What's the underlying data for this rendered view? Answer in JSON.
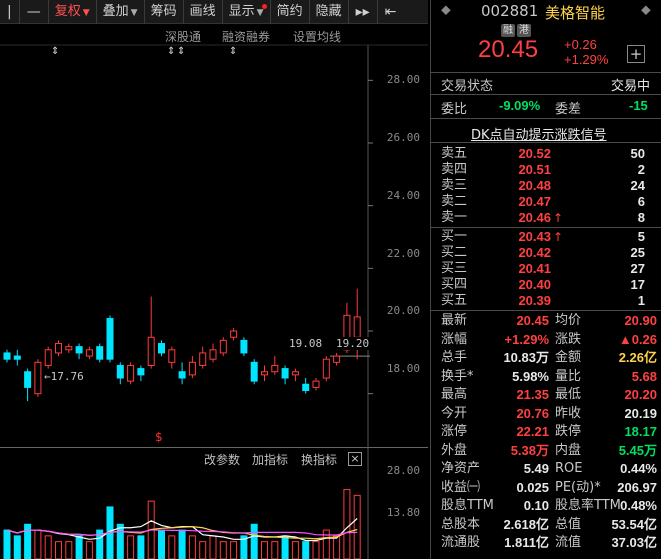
{
  "toolbar": {
    "collapse_label": "|",
    "minus_label": "—",
    "adjust_label": "复权",
    "overlay_label": "叠加",
    "chips_label": "筹码",
    "draw_label": "画线",
    "display_label": "显示",
    "simple_label": "简约",
    "hide_label": "隐藏",
    "next_label": "▸▸",
    "expand_label": "⇤"
  },
  "chart": {
    "menu": [
      "深股通",
      "融资融券",
      "设置均线"
    ],
    "markers": [
      "⇕",
      "⇕",
      "⇕",
      "⇕"
    ],
    "price_axis": [
      "28.00",
      "26.00",
      "24.00",
      "22.00",
      "20.00",
      "18.00"
    ],
    "low_annotation": "←17.76",
    "price_tag_left": "19.08",
    "price_tag_right": "19.20",
    "indicator_buttons": [
      "改参数",
      "加指标",
      "换指标"
    ],
    "indicator_close": "×",
    "indicator_signal": "$",
    "volume_axis": [
      "28.00",
      "13.80"
    ],
    "up_color": "#ff3b3b",
    "down_color": "#00e5ff"
  },
  "chart_data": {
    "type": "candlestick",
    "ylim": [
      17.0,
      29.0
    ],
    "candles": [
      {
        "o": 19.3,
        "c": 19.1,
        "h": 19.4,
        "l": 19.0,
        "v": 5
      },
      {
        "o": 19.2,
        "c": 19.1,
        "h": 19.4,
        "l": 18.9,
        "v": 4
      },
      {
        "o": 18.7,
        "c": 18.2,
        "h": 18.8,
        "l": 17.76,
        "v": 6
      },
      {
        "o": 18.0,
        "c": 19.0,
        "h": 19.1,
        "l": 17.9,
        "v": 5
      },
      {
        "o": 18.9,
        "c": 19.4,
        "h": 19.5,
        "l": 18.8,
        "v": 4
      },
      {
        "o": 19.3,
        "c": 19.6,
        "h": 19.7,
        "l": 19.2,
        "v": 3
      },
      {
        "o": 19.4,
        "c": 19.5,
        "h": 19.6,
        "l": 19.3,
        "v": 3
      },
      {
        "o": 19.5,
        "c": 19.3,
        "h": 19.6,
        "l": 19.1,
        "v": 4
      },
      {
        "o": 19.2,
        "c": 19.4,
        "h": 19.5,
        "l": 19.1,
        "v": 3
      },
      {
        "o": 19.5,
        "c": 19.1,
        "h": 19.6,
        "l": 19.0,
        "v": 5
      },
      {
        "o": 20.4,
        "c": 19.1,
        "h": 20.5,
        "l": 19.0,
        "v": 9
      },
      {
        "o": 18.9,
        "c": 18.5,
        "h": 19.0,
        "l": 18.3,
        "v": 6
      },
      {
        "o": 18.4,
        "c": 18.9,
        "h": 19.0,
        "l": 18.3,
        "v": 4
      },
      {
        "o": 18.8,
        "c": 18.6,
        "h": 18.9,
        "l": 18.4,
        "v": 4
      },
      {
        "o": 18.9,
        "c": 19.8,
        "h": 21.1,
        "l": 18.8,
        "v": 10
      },
      {
        "o": 19.6,
        "c": 19.3,
        "h": 19.7,
        "l": 19.2,
        "v": 5
      },
      {
        "o": 19.0,
        "c": 19.4,
        "h": 19.5,
        "l": 18.8,
        "v": 4
      },
      {
        "o": 18.7,
        "c": 18.5,
        "h": 19.0,
        "l": 18.3,
        "v": 5
      },
      {
        "o": 18.6,
        "c": 19.0,
        "h": 19.2,
        "l": 18.5,
        "v": 4
      },
      {
        "o": 18.9,
        "c": 19.3,
        "h": 19.5,
        "l": 18.8,
        "v": 3
      },
      {
        "o": 19.1,
        "c": 19.4,
        "h": 19.6,
        "l": 19.0,
        "v": 4
      },
      {
        "o": 19.3,
        "c": 19.7,
        "h": 19.8,
        "l": 19.2,
        "v": 3
      },
      {
        "o": 19.8,
        "c": 20.0,
        "h": 20.1,
        "l": 19.7,
        "v": 3
      },
      {
        "o": 19.7,
        "c": 19.3,
        "h": 19.8,
        "l": 19.2,
        "v": 4
      },
      {
        "o": 19.0,
        "c": 18.4,
        "h": 19.1,
        "l": 18.3,
        "v": 6
      },
      {
        "o": 18.6,
        "c": 18.7,
        "h": 18.9,
        "l": 18.4,
        "v": 3
      },
      {
        "o": 18.7,
        "c": 18.9,
        "h": 19.2,
        "l": 18.6,
        "v": 3
      },
      {
        "o": 18.8,
        "c": 18.5,
        "h": 18.9,
        "l": 18.3,
        "v": 4
      },
      {
        "o": 18.6,
        "c": 18.7,
        "h": 18.8,
        "l": 18.4,
        "v": 3
      },
      {
        "o": 18.3,
        "c": 18.1,
        "h": 18.5,
        "l": 18.0,
        "v": 3
      },
      {
        "o": 18.2,
        "c": 18.4,
        "h": 18.5,
        "l": 18.1,
        "v": 3
      },
      {
        "o": 18.5,
        "c": 19.1,
        "h": 19.2,
        "l": 18.4,
        "v": 5
      },
      {
        "o": 19.0,
        "c": 19.2,
        "h": 19.3,
        "l": 18.9,
        "v": 4
      },
      {
        "o": 19.4,
        "c": 20.5,
        "h": 20.9,
        "l": 19.3,
        "v": 12
      },
      {
        "o": 19.8,
        "c": 20.45,
        "h": 21.35,
        "l": 19.1,
        "v": 11
      }
    ]
  },
  "stock": {
    "code": "002881",
    "name": "美格智能",
    "arrow_left": "⬥",
    "arrow_right": "⬥",
    "badge_margin": "融",
    "badge_hk": "港",
    "price": "20.45",
    "change": "+0.26",
    "change_pct": "+1.29%",
    "add_label": "+"
  },
  "trade_status": {
    "label": "交易状态",
    "value": "交易中"
  },
  "order_ratio": {
    "label1": "委比",
    "value1": "-9.09%",
    "label2": "委差",
    "value2": "-15"
  },
  "dk_signal": "DK点自动提示涨跌信号",
  "asks": [
    {
      "label": "卖五",
      "price": "20.52",
      "arrow": "",
      "vol": "50"
    },
    {
      "label": "卖四",
      "price": "20.51",
      "arrow": "",
      "vol": "2"
    },
    {
      "label": "卖三",
      "price": "20.48",
      "arrow": "",
      "vol": "24"
    },
    {
      "label": "卖二",
      "price": "20.47",
      "arrow": "",
      "vol": "6"
    },
    {
      "label": "卖一",
      "price": "20.46",
      "arrow": "↑",
      "vol": "8"
    }
  ],
  "bids": [
    {
      "label": "买一",
      "price": "20.43",
      "arrow": "↑",
      "vol": "5"
    },
    {
      "label": "买二",
      "price": "20.42",
      "arrow": "",
      "vol": "25"
    },
    {
      "label": "买三",
      "price": "20.41",
      "arrow": "",
      "vol": "27"
    },
    {
      "label": "买四",
      "price": "20.40",
      "arrow": "",
      "vol": "17"
    },
    {
      "label": "买五",
      "price": "20.39",
      "arrow": "",
      "vol": "1"
    }
  ],
  "stats": [
    {
      "l1": "最新",
      "v1": "20.45",
      "c1": "red",
      "l2": "均价",
      "v2": "20.90",
      "c2": "red"
    },
    {
      "l1": "涨幅",
      "v1": "+1.29%",
      "c1": "red",
      "l2": "涨跌",
      "v2": "▲0.26",
      "c2": "red"
    },
    {
      "l1": "总手",
      "v1": "10.83万",
      "c1": "wht",
      "l2": "金额",
      "v2": "2.26亿",
      "c2": "yel"
    },
    {
      "l1": "换手*",
      "v1": "5.98%",
      "c1": "wht",
      "l2": "量比",
      "v2": "5.68",
      "c2": "red"
    },
    {
      "l1": "最高",
      "v1": "21.35",
      "c1": "red",
      "l2": "最低",
      "v2": "20.20",
      "c2": "red"
    },
    {
      "l1": "今开",
      "v1": "20.76",
      "c1": "red",
      "l2": "昨收",
      "v2": "20.19",
      "c2": "wht"
    },
    {
      "l1": "涨停",
      "v1": "22.21",
      "c1": "red",
      "l2": "跌停",
      "v2": "18.17",
      "c2": "green"
    },
    {
      "l1": "外盘",
      "v1": "5.38万",
      "c1": "red",
      "l2": "内盘",
      "v2": "5.45万",
      "c2": "green"
    },
    {
      "l1": "净资产",
      "v1": "5.49",
      "c1": "wht",
      "l2": "ROE",
      "v2": "0.44%",
      "c2": "wht"
    },
    {
      "l1": "收益㈠",
      "v1": "0.025",
      "c1": "wht",
      "l2": "PE(动)*",
      "v2": "206.97",
      "c2": "wht"
    },
    {
      "l1": "股息TTM",
      "v1": "0.10",
      "c1": "wht",
      "l2": "股息率TTM",
      "v2": "0.48%",
      "c2": "wht"
    },
    {
      "l1": "总股本",
      "v1": "2.618亿",
      "c1": "wht",
      "l2": "总值",
      "v2": "53.54亿",
      "c2": "wht"
    },
    {
      "l1": "流通股",
      "v1": "1.811亿",
      "c1": "wht",
      "l2": "流值",
      "v2": "37.03亿",
      "c2": "wht"
    }
  ]
}
